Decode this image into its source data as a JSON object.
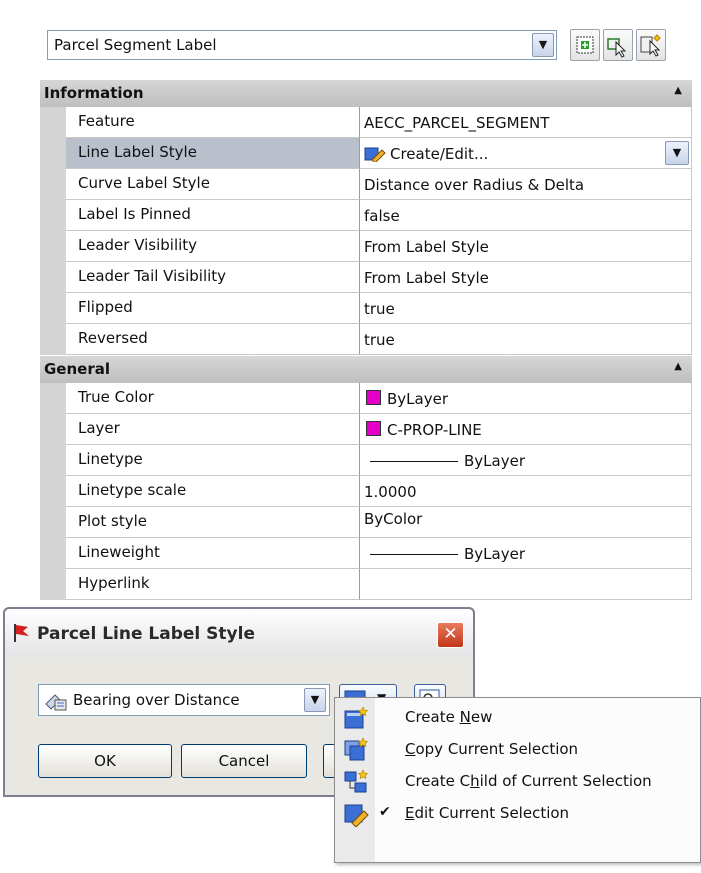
{
  "selector": {
    "value": "Parcel Segment Label"
  },
  "grid": {
    "information": {
      "title": "Information",
      "rows": [
        {
          "name": "Feature",
          "value": "AECC_PARCEL_SEGMENT"
        },
        {
          "name": "Line Label Style",
          "value": "Create/Edit..."
        },
        {
          "name": "Curve Label Style",
          "value": "Distance over Radius & Delta"
        },
        {
          "name": "Label Is Pinned",
          "value": "false"
        },
        {
          "name": "Leader Visibility",
          "value": "From Label Style"
        },
        {
          "name": "Leader Tail Visibility",
          "value": "From Label Style"
        },
        {
          "name": "Flipped",
          "value": "true"
        },
        {
          "name": "Reversed",
          "value": "true"
        }
      ]
    },
    "general": {
      "title": "General",
      "rows": [
        {
          "name": "True Color",
          "value": "ByLayer"
        },
        {
          "name": "Layer",
          "value": "C-PROP-LINE"
        },
        {
          "name": "Linetype",
          "value": "ByLayer"
        },
        {
          "name": "Linetype scale",
          "value": "1.0000"
        },
        {
          "name": "Plot style",
          "value": "ByColor"
        },
        {
          "name": "Lineweight",
          "value": "ByLayer"
        },
        {
          "name": "Hyperlink",
          "value": ""
        }
      ]
    }
  },
  "dialog": {
    "title": "Parcel Line Label Style",
    "style_value": "Bearing over Distance",
    "ok_label": "OK",
    "cancel_label": "Cancel"
  },
  "menu": {
    "items": [
      {
        "pre": "Create ",
        "key": "N",
        "post": "ew",
        "checked": false
      },
      {
        "pre": "",
        "key": "C",
        "post": "opy Current Selection",
        "checked": false
      },
      {
        "pre": "Create C",
        "key": "h",
        "post": "ild of Current Selection",
        "checked": false
      },
      {
        "pre": "",
        "key": "E",
        "post": "dit Current Selection",
        "checked": true
      }
    ]
  },
  "colors": {
    "layer_color": "#e400c8",
    "selected_row": "#b9c0cc",
    "category_header": "#c8c8c8"
  }
}
